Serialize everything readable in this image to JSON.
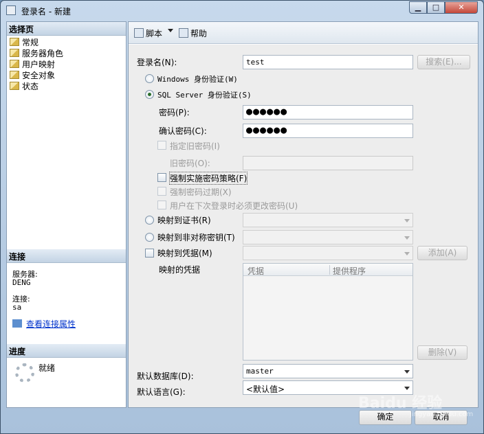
{
  "window": {
    "title": "登录名 - 新建"
  },
  "left": {
    "select_page_header": "选择页",
    "nav_items": [
      "常规",
      "服务器角色",
      "用户映射",
      "安全对象",
      "状态"
    ],
    "connection_header": "连接",
    "server_label": "服务器:",
    "server_value": "DENG",
    "connection_label": "连接:",
    "connection_value": "sa",
    "view_connection_properties": "查看连接属性",
    "progress_header": "进度",
    "progress_status": "就绪"
  },
  "toolbar": {
    "script_label": "脚本",
    "help_label": "帮助"
  },
  "form": {
    "login_name_label": "登录名(N):",
    "login_name_value": "test",
    "search_button": "搜索(E)...",
    "windows_auth": "Windows 身份验证(W)",
    "sql_auth": "SQL Server 身份验证(S)",
    "password_label": "密码(P):",
    "password_value": "●●●●●●",
    "confirm_password_label": "确认密码(C):",
    "confirm_password_value": "●●●●●●",
    "specify_old_password": "指定旧密码(I)",
    "old_password_label": "旧密码(O):",
    "enforce_policy": "强制实施密码策略(F)",
    "enforce_expiration": "强制密码过期(X)",
    "must_change": "用户在下次登录时必须更改密码(U)",
    "map_certificate": "映射到证书(R)",
    "map_asymmetric_key": "映射到非对称密钥(T)",
    "map_credential": "映射到凭据(M)",
    "add_button": "添加(A)",
    "mapped_credentials_label": "映射的凭据",
    "grid_col_credential": "凭据",
    "grid_col_provider": "提供程序",
    "remove_button": "删除(V)",
    "default_database_label": "默认数据库(D):",
    "default_database_value": "master",
    "default_language_label": "默认语言(G):",
    "default_language_value": "<默认值>"
  },
  "footer": {
    "ok_button": "确定",
    "cancel_button": "取消"
  },
  "watermark": {
    "text": "Baidu 经验",
    "sub": "jingyan.baidu.com"
  }
}
